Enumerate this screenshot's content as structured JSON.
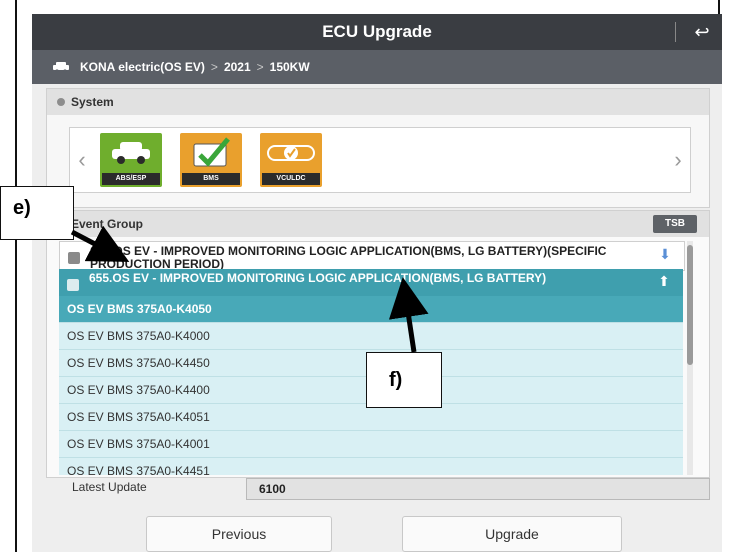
{
  "title": "ECU Upgrade",
  "breadcrumb": {
    "model": "KONA electric(OS EV)",
    "year": "2021",
    "variant": "150KW"
  },
  "system": {
    "label": "System",
    "tiles": [
      {
        "caption": "ABS/ESP",
        "icon": "car-icon"
      },
      {
        "caption": "BMS",
        "icon": "battery-check-icon"
      },
      {
        "caption": "VCULDC",
        "icon": "vcu-ldc-icon"
      }
    ]
  },
  "event_group": {
    "label": "Event Group",
    "tsb_label": "TSB",
    "groups": [
      {
        "text": "656.OS EV - IMPROVED MONITORING LOGIC APPLICATION(BMS, LG BATTERY)(SPECIFIC PRODUCTION PERIOD)",
        "expanded": false
      },
      {
        "text": "655.OS EV - IMPROVED MONITORING LOGIC APPLICATION(BMS, LG BATTERY)",
        "expanded": true
      }
    ],
    "items": [
      "OS EV BMS 375A0-K4050",
      "OS EV BMS 375A0-K4000",
      "OS EV BMS 375A0-K4450",
      "OS EV BMS 375A0-K4400",
      "OS EV BMS 375A0-K4051",
      "OS EV BMS 375A0-K4001",
      "OS EV BMS 375A0-K4451"
    ],
    "selected_item": "OS EV BMS 375A0-K4050"
  },
  "latest_update": {
    "label": "Latest Update",
    "value": "6100"
  },
  "buttons": {
    "previous": "Previous",
    "upgrade": "Upgrade"
  },
  "annotations": {
    "e": "e)",
    "f": "f)"
  },
  "colors": {
    "header": "#3a3d42",
    "breadcrumb": "#5b5f66",
    "selected": "#48a9b8",
    "list_bg": "#d9f0f4"
  }
}
